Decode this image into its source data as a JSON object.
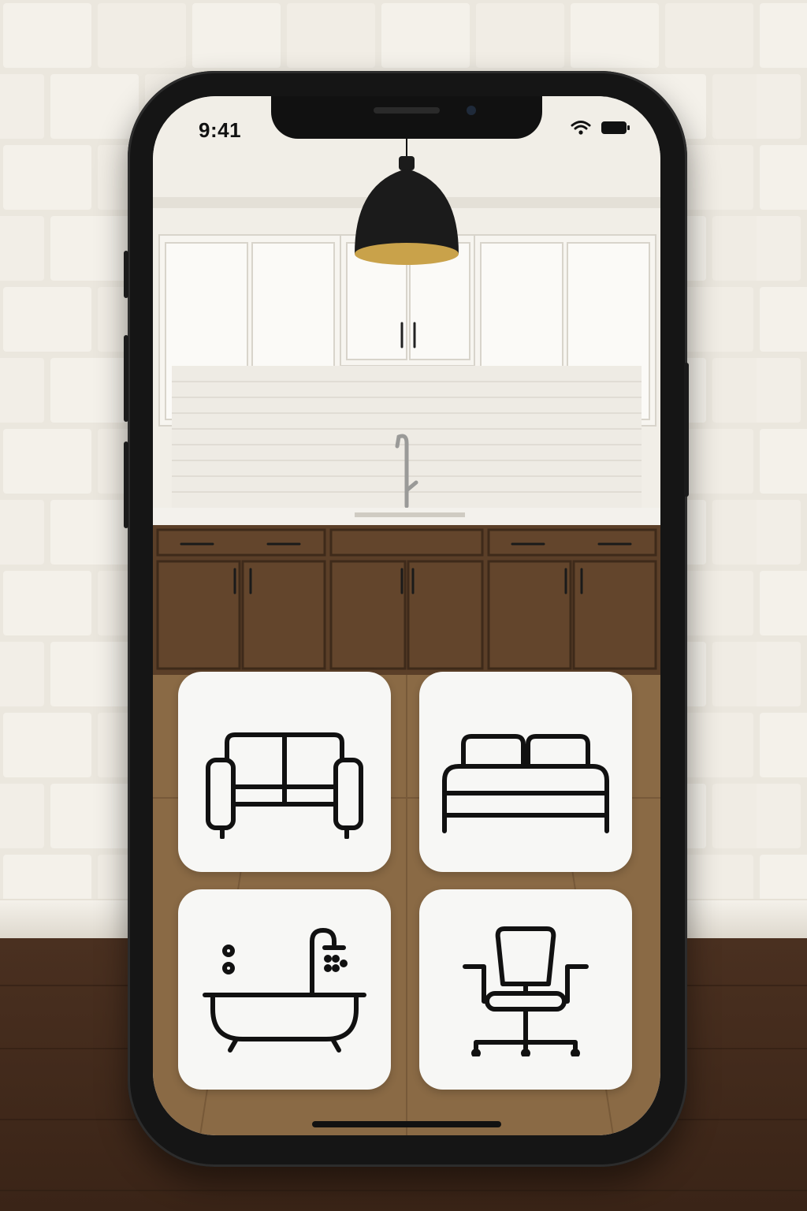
{
  "status_bar": {
    "time": "9:41",
    "icons": [
      "wifi-icon",
      "battery-icon"
    ]
  },
  "scene": {
    "description_icons": [
      "pendant-lamp",
      "kitchen-cabinets",
      "faucet"
    ]
  },
  "categories": [
    {
      "icon": "sofa-icon"
    },
    {
      "icon": "bed-icon"
    },
    {
      "icon": "bathtub-icon"
    },
    {
      "icon": "office-chair-icon"
    }
  ],
  "colors": {
    "upper_cabinets": "#f6f4ef",
    "lower_cabinets": "#5a3e27",
    "lamp_shade": "#1b1b1b",
    "lamp_inner": "#c9a24a",
    "tile_background": "#f7f7f5",
    "icon_stroke": "#111111"
  }
}
